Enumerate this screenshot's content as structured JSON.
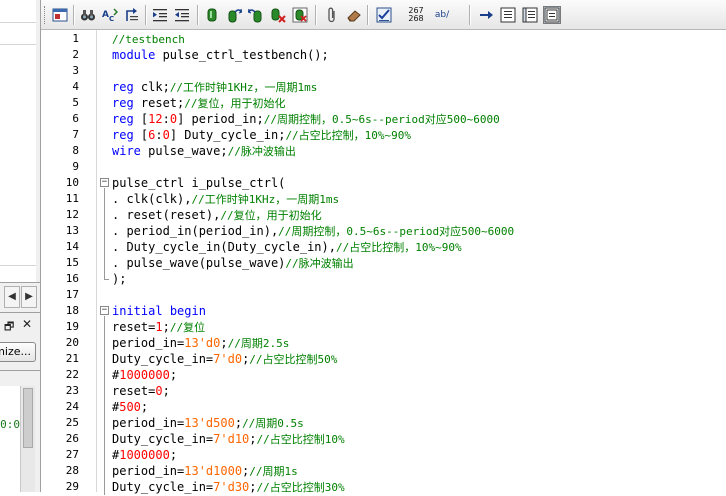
{
  "left_panel": {
    "customize_label": "mize...",
    "watch_value": "0:0",
    "scroll_left": "◀",
    "scroll_right": "▶"
  },
  "toolbar": {
    "line_numbers_top": "267",
    "line_numbers_bottom": "268",
    "spell_label": "ab/"
  },
  "editor": {
    "lines": [
      {
        "n": "1",
        "fold": "",
        "segs": [
          {
            "t": "//testbench",
            "c": "cm"
          }
        ]
      },
      {
        "n": "2",
        "fold": "",
        "segs": [
          {
            "t": "module",
            "c": "kw"
          },
          {
            "t": " pulse_ctrl_testbench();",
            "c": ""
          }
        ]
      },
      {
        "n": "3",
        "fold": "",
        "segs": []
      },
      {
        "n": "4",
        "fold": "",
        "segs": [
          {
            "t": "reg",
            "c": "kw"
          },
          {
            "t": " clk;",
            "c": ""
          },
          {
            "t": "//工作时钟1KHz，一周期1ms",
            "c": "cm"
          }
        ]
      },
      {
        "n": "5",
        "fold": "",
        "segs": [
          {
            "t": "reg",
            "c": "kw"
          },
          {
            "t": " reset;",
            "c": ""
          },
          {
            "t": "//复位，用于初始化",
            "c": "cm"
          }
        ]
      },
      {
        "n": "6",
        "fold": "",
        "segs": [
          {
            "t": "reg",
            "c": "kw"
          },
          {
            "t": " [",
            "c": ""
          },
          {
            "t": "12",
            "c": "num"
          },
          {
            "t": ":",
            "c": ""
          },
          {
            "t": "0",
            "c": "num"
          },
          {
            "t": "] period_in;",
            "c": ""
          },
          {
            "t": "//周期控制，0.5~6s--period对应500~6000",
            "c": "cm"
          }
        ]
      },
      {
        "n": "7",
        "fold": "",
        "segs": [
          {
            "t": "reg",
            "c": "kw"
          },
          {
            "t": " [",
            "c": ""
          },
          {
            "t": "6",
            "c": "num"
          },
          {
            "t": ":",
            "c": ""
          },
          {
            "t": "0",
            "c": "num"
          },
          {
            "t": "] Duty_cycle_in;",
            "c": ""
          },
          {
            "t": "//占空比控制，10%~90%",
            "c": "cm"
          }
        ]
      },
      {
        "n": "8",
        "fold": "",
        "segs": [
          {
            "t": "wire",
            "c": "kw"
          },
          {
            "t": " pulse_wave;",
            "c": ""
          },
          {
            "t": "//脉冲波输出",
            "c": "cm"
          }
        ]
      },
      {
        "n": "9",
        "fold": "",
        "segs": []
      },
      {
        "n": "10",
        "fold": "start",
        "segs": [
          {
            "t": "pulse_ctrl i_pulse_ctrl(",
            "c": ""
          }
        ]
      },
      {
        "n": "11",
        "fold": "mid",
        "segs": [
          {
            "t": ". clk(clk),",
            "c": ""
          },
          {
            "t": "//工作时钟1KHz，一周期1ms",
            "c": "cm"
          }
        ]
      },
      {
        "n": "12",
        "fold": "mid",
        "segs": [
          {
            "t": ". reset(reset),",
            "c": ""
          },
          {
            "t": "//复位，用于初始化",
            "c": "cm"
          }
        ]
      },
      {
        "n": "13",
        "fold": "mid",
        "segs": [
          {
            "t": ". period_in(period_in),",
            "c": ""
          },
          {
            "t": "//周期控制，0.5~6s--period对应500~6000",
            "c": "cm"
          }
        ]
      },
      {
        "n": "14",
        "fold": "mid",
        "segs": [
          {
            "t": ". Duty_cycle_in(Duty_cycle_in),",
            "c": ""
          },
          {
            "t": "//占空比控制，10%~90%",
            "c": "cm"
          }
        ]
      },
      {
        "n": "15",
        "fold": "mid",
        "segs": [
          {
            "t": ". pulse_wave(pulse_wave)",
            "c": ""
          },
          {
            "t": "//脉冲波输出",
            "c": "cm"
          }
        ]
      },
      {
        "n": "16",
        "fold": "end",
        "segs": [
          {
            "t": ");",
            "c": ""
          }
        ]
      },
      {
        "n": "17",
        "fold": "",
        "segs": []
      },
      {
        "n": "18",
        "fold": "start",
        "segs": [
          {
            "t": "initial",
            "c": "kw"
          },
          {
            "t": " ",
            "c": ""
          },
          {
            "t": "begin",
            "c": "kw"
          }
        ]
      },
      {
        "n": "19",
        "fold": "mid",
        "segs": [
          {
            "t": "reset=",
            "c": ""
          },
          {
            "t": "1",
            "c": "num"
          },
          {
            "t": ";",
            "c": ""
          },
          {
            "t": "//复位",
            "c": "cm"
          }
        ]
      },
      {
        "n": "20",
        "fold": "mid",
        "segs": [
          {
            "t": "period_in=",
            "c": ""
          },
          {
            "t": "13'd0",
            "c": "hex"
          },
          {
            "t": ";",
            "c": ""
          },
          {
            "t": "//周期2.5s",
            "c": "cm"
          }
        ]
      },
      {
        "n": "21",
        "fold": "mid",
        "segs": [
          {
            "t": "Duty_cycle_in=",
            "c": ""
          },
          {
            "t": "7'd0",
            "c": "hex"
          },
          {
            "t": ";",
            "c": ""
          },
          {
            "t": "//占空比控制50%",
            "c": "cm"
          }
        ]
      },
      {
        "n": "22",
        "fold": "mid",
        "segs": [
          {
            "t": "#",
            "c": ""
          },
          {
            "t": "1000000",
            "c": "num"
          },
          {
            "t": ";",
            "c": ""
          }
        ]
      },
      {
        "n": "23",
        "fold": "mid",
        "segs": [
          {
            "t": "reset=",
            "c": ""
          },
          {
            "t": "0",
            "c": "num"
          },
          {
            "t": ";",
            "c": ""
          }
        ]
      },
      {
        "n": "24",
        "fold": "mid",
        "segs": [
          {
            "t": "#",
            "c": ""
          },
          {
            "t": "500",
            "c": "num"
          },
          {
            "t": ";",
            "c": ""
          }
        ]
      },
      {
        "n": "25",
        "fold": "mid",
        "segs": [
          {
            "t": "period_in=",
            "c": ""
          },
          {
            "t": "13'd500",
            "c": "hex"
          },
          {
            "t": ";",
            "c": ""
          },
          {
            "t": "//周期0.5s",
            "c": "cm"
          }
        ]
      },
      {
        "n": "26",
        "fold": "mid",
        "segs": [
          {
            "t": "Duty_cycle_in=",
            "c": ""
          },
          {
            "t": "7'd10",
            "c": "hex"
          },
          {
            "t": ";",
            "c": ""
          },
          {
            "t": "//占空比控制10%",
            "c": "cm"
          }
        ]
      },
      {
        "n": "27",
        "fold": "mid",
        "segs": [
          {
            "t": "#",
            "c": ""
          },
          {
            "t": "1000000",
            "c": "num"
          },
          {
            "t": ";",
            "c": ""
          }
        ]
      },
      {
        "n": "28",
        "fold": "mid",
        "segs": [
          {
            "t": "period_in=",
            "c": ""
          },
          {
            "t": "13'd1000",
            "c": "hex"
          },
          {
            "t": ";",
            "c": ""
          },
          {
            "t": "//周期1s",
            "c": "cm"
          }
        ]
      },
      {
        "n": "29",
        "fold": "mid",
        "segs": [
          {
            "t": "Duty_cycle_in=",
            "c": ""
          },
          {
            "t": "7'd30",
            "c": "hex"
          },
          {
            "t": ";",
            "c": ""
          },
          {
            "t": "//占空比控制30%",
            "c": "cm"
          }
        ]
      }
    ]
  }
}
